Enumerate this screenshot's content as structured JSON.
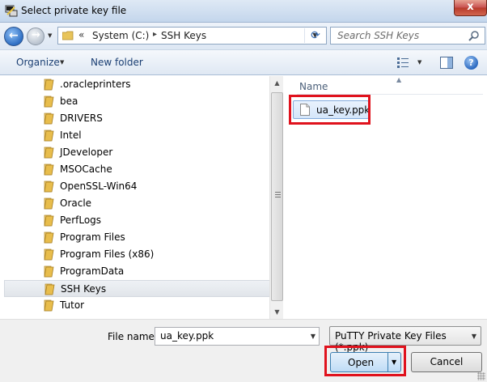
{
  "window": {
    "title": "Select private key file",
    "close_glyph": "x"
  },
  "address": {
    "chevron": "«",
    "segments": [
      "System (C:)",
      "SSH Keys"
    ],
    "separator": "▸",
    "search_placeholder": "Search SSH Keys"
  },
  "toolbar": {
    "organize_label": "Organize",
    "new_folder_label": "New folder",
    "help_glyph": "?"
  },
  "tree": {
    "items": [
      {
        "label": ".oracleprinters"
      },
      {
        "label": "bea"
      },
      {
        "label": "DRIVERS"
      },
      {
        "label": "Intel"
      },
      {
        "label": "JDeveloper"
      },
      {
        "label": "MSOCache"
      },
      {
        "label": "OpenSSL-Win64"
      },
      {
        "label": "Oracle"
      },
      {
        "label": "PerfLogs"
      },
      {
        "label": "Program Files"
      },
      {
        "label": "Program Files (x86)"
      },
      {
        "label": "ProgramData"
      },
      {
        "label": "SSH Keys",
        "selected": true
      },
      {
        "label": "Tutor"
      }
    ]
  },
  "files": {
    "column_name": "Name",
    "items": [
      {
        "label": "ua_key.ppk",
        "selected": true
      }
    ]
  },
  "bottom": {
    "file_name_label": "File name:",
    "file_name_value": "ua_key.ppk",
    "filter_value": "PuTTY Private Key Files (*.ppk)",
    "open_label": "Open",
    "cancel_label": "Cancel"
  },
  "colors": {
    "annotation": "#e0121d",
    "selection": "#d5e6fa",
    "folder": "#e8c45a"
  }
}
